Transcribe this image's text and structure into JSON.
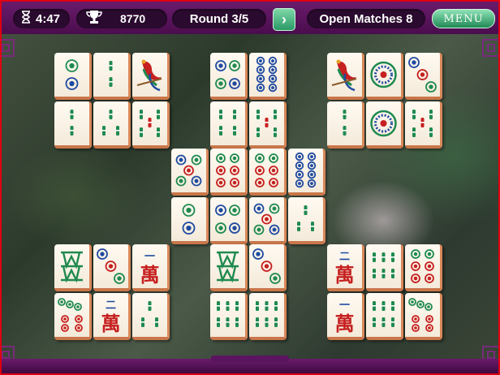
{
  "hud": {
    "timer_icon": "hourglass-icon",
    "time": "4:47",
    "score_icon": "trophy-icon",
    "score": "8770",
    "round": "Round 3/5",
    "next_icon": "chevron-right-icon",
    "open_matches": "Open Matches 8",
    "menu": "MENU"
  },
  "colors": {
    "bar": "#5a1460",
    "pill": "#2a0a2e",
    "accent_green": "#2a9a66",
    "tile_edge": "#d9885a",
    "frame": "#e00010"
  },
  "tiles": [
    {
      "face": "c2v"
    },
    {
      "face": "b2"
    },
    {
      "face": "bird"
    },
    {
      "face": "b2"
    },
    {
      "face": "b3"
    },
    {
      "face": "b5r"
    },
    {
      "face": "c4"
    },
    {
      "face": "c8"
    },
    {
      "face": "b4"
    },
    {
      "face": "b5r"
    },
    {
      "face": "bird"
    },
    {
      "face": "c1big"
    },
    {
      "face": "c3"
    },
    {
      "face": "b2"
    },
    {
      "face": "c1big"
    },
    {
      "face": "b5r"
    },
    {
      "face": "c5"
    },
    {
      "face": "c6"
    },
    {
      "face": "c6"
    },
    {
      "face": "c8"
    },
    {
      "face": "c2v"
    },
    {
      "face": "c4"
    },
    {
      "face": "c5"
    },
    {
      "face": "b3"
    },
    {
      "face": "w"
    },
    {
      "face": "c3"
    },
    {
      "face": "char",
      "num": "一",
      "glyph": "萬"
    },
    {
      "face": "c7"
    },
    {
      "face": "char",
      "num": "二",
      "glyph": "萬"
    },
    {
      "face": "b3"
    },
    {
      "face": "w"
    },
    {
      "face": "c3"
    },
    {
      "face": "b6"
    },
    {
      "face": "b6"
    },
    {
      "face": "char",
      "num": "二",
      "glyph": "萬"
    },
    {
      "face": "b6"
    },
    {
      "face": "c6"
    },
    {
      "face": "char",
      "num": "一",
      "glyph": "萬"
    },
    {
      "face": "b6"
    },
    {
      "face": "c7"
    }
  ]
}
